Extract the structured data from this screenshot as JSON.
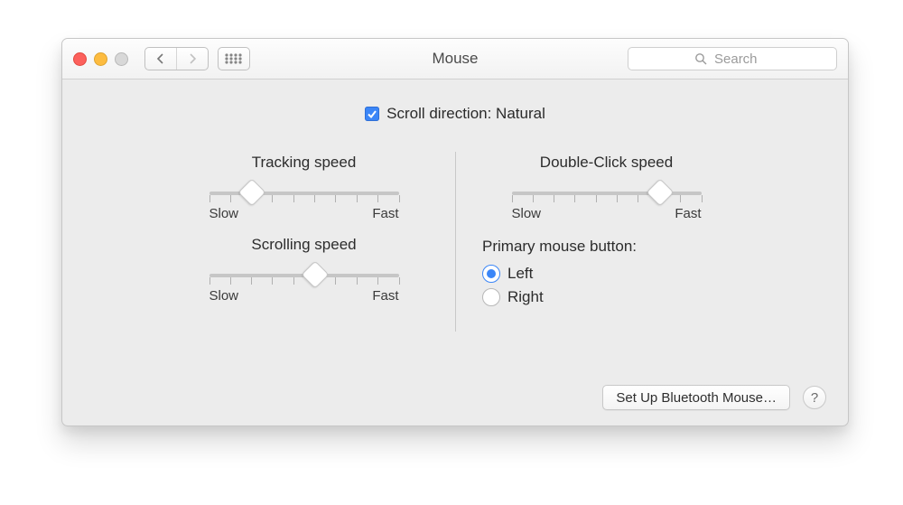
{
  "window": {
    "title": "Mouse"
  },
  "search": {
    "placeholder": "Search",
    "value": ""
  },
  "scroll_direction": {
    "label": "Scroll direction: Natural",
    "checked": true
  },
  "sliders": {
    "ticks": 10,
    "tracking": {
      "label": "Tracking speed",
      "min_label": "Slow",
      "max_label": "Fast",
      "value": 2
    },
    "doubleclick": {
      "label": "Double-Click speed",
      "min_label": "Slow",
      "max_label": "Fast",
      "value": 7
    },
    "scrolling": {
      "label": "Scrolling speed",
      "min_label": "Slow",
      "max_label": "Fast",
      "value": 5
    }
  },
  "primary_button": {
    "label": "Primary mouse button:",
    "options": {
      "left": "Left",
      "right": "Right"
    },
    "selected": "left"
  },
  "buttons": {
    "setup_bluetooth": "Set Up Bluetooth Mouse…"
  }
}
